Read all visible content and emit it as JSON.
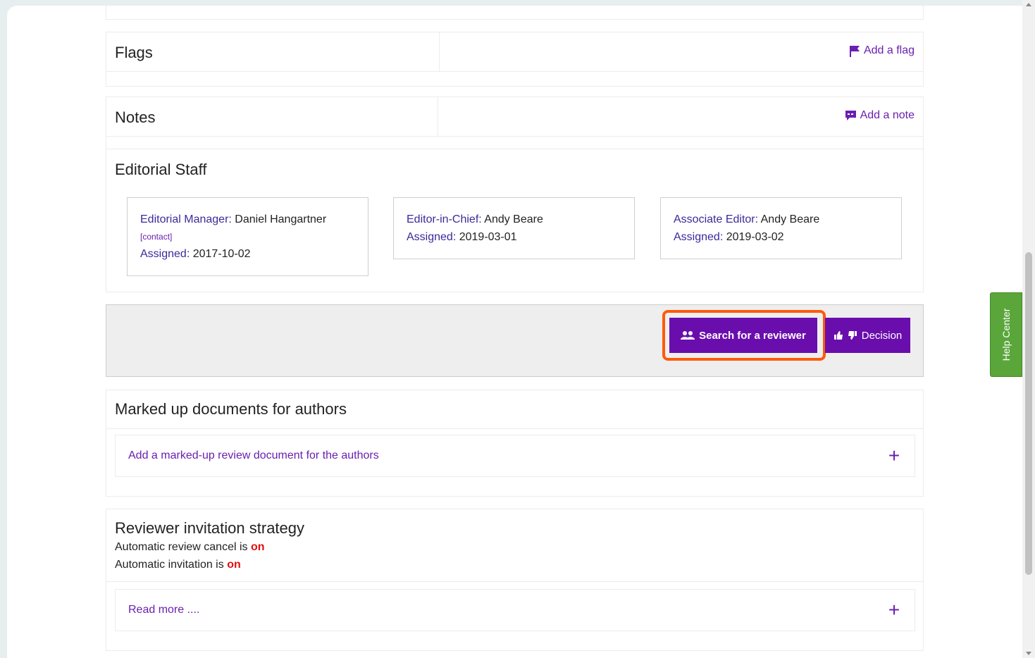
{
  "flags": {
    "title": "Flags",
    "action": "Add a flag"
  },
  "notes": {
    "title": "Notes",
    "action": "Add a note"
  },
  "editorial_staff": {
    "title": "Editorial Staff",
    "cards": [
      {
        "role": "Editorial Manager:",
        "name": "Daniel Hangartner",
        "contact": "[contact]",
        "assigned_label": "Assigned:",
        "assigned": "2017-10-02"
      },
      {
        "role": "Editor-in-Chief:",
        "name": "Andy Beare",
        "assigned_label": "Assigned:",
        "assigned": "2019-03-01"
      },
      {
        "role": "Associate Editor:",
        "name": "Andy Beare",
        "assigned_label": "Assigned:",
        "assigned": "2019-03-02"
      }
    ]
  },
  "toolbar": {
    "search_label": "Search for a reviewer",
    "decision_label": "Decision"
  },
  "docs": {
    "title": "Marked up documents for authors",
    "add_link": "Add a marked-up review document for the authors"
  },
  "strategy": {
    "title": "Reviewer invitation strategy",
    "cancel_text": "Automatic review cancel is",
    "cancel_state": "on",
    "invitation_text": "Automatic invitation is",
    "invitation_state": "on",
    "read_more": "Read more ...."
  },
  "help_center": "Help Center",
  "colors": {
    "accent": "#6a0dad",
    "link": "#6a1fb0",
    "highlight": "#ff5a0a",
    "on": "#e01010",
    "help": "#5aa63a"
  }
}
